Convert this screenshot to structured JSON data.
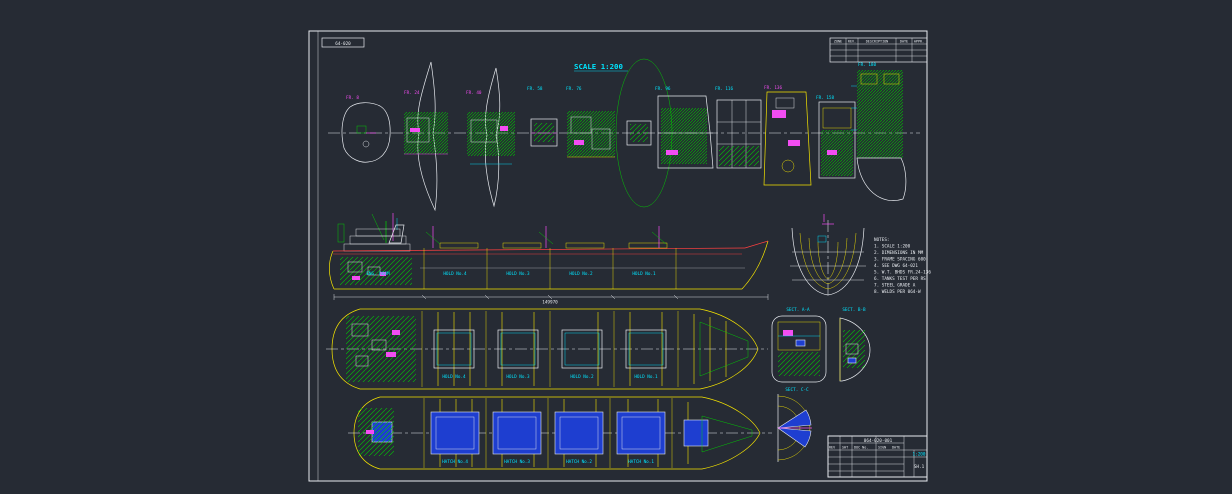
{
  "palette": {
    "background": "#262b34",
    "line_white": "#e8ebf0",
    "green": "#00d400",
    "magenta": "#f24df2",
    "cyan": "#00e5ff",
    "yellow": "#f5e400",
    "red": "#ff4040",
    "blue_fill": "#1e3ed0"
  },
  "sheet": {
    "drawing_no": "64-020",
    "scale_label": "SCALE 1:200"
  },
  "rev_table": {
    "headers": [
      "ZONE",
      "REV.",
      "DESCRIPTION",
      "DATE",
      "APPR."
    ]
  },
  "sections": {
    "labels": [
      "FR. 8",
      "FR. 24",
      "FR. 40",
      "FR. 58",
      "FR. 76",
      "FR. 96",
      "FR. 116",
      "FR. 136",
      "FR. 158",
      "FR. 180"
    ]
  },
  "profile": {
    "compartments": [
      "ENG. ROOM",
      "HOLD No.4",
      "HOLD No.3",
      "HOLD No.2",
      "HOLD No.1"
    ],
    "dimension": "149970"
  },
  "notes": {
    "lines": [
      "NOTES:",
      "1. SCALE 1:200",
      "2. DIMENSIONS IN MM",
      "3. FRAME SPACING 600",
      "4. SEE DWG 64-021",
      "5. W.T. BHDS FR.24-136",
      "6. TANKS TEST PER RS",
      "7. STEEL GRADE A",
      "8. WELDS PER 064-W"
    ]
  },
  "plans": {
    "upper": {
      "compartments": [
        "HOLD No.4",
        "HOLD No.3",
        "HOLD No.2",
        "HOLD No.1"
      ]
    },
    "lower": {
      "compartments": [
        "HATCH No.4",
        "HATCH No.3",
        "HATCH No.2",
        "HATCH No.1"
      ]
    }
  },
  "aux": {
    "labels": [
      "SECT. A-A",
      "SECT. B-B",
      "SECT. C-C"
    ]
  },
  "title_block": {
    "code": "064-020-001",
    "scale": "1:200",
    "sheet": "SH.1",
    "row_labels": [
      "REV",
      "SHT",
      "DOC No.",
      "SIGN",
      "DATE"
    ]
  }
}
